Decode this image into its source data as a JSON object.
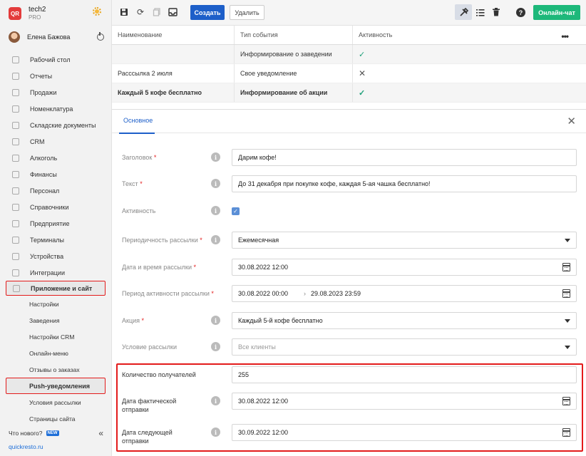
{
  "brand": {
    "logo_text": "QR",
    "name": "tech2",
    "plan": "PRO"
  },
  "user": {
    "name": "Елена Бажова"
  },
  "menu": [
    {
      "label": "Рабочий стол",
      "icon": "dashboard-icon"
    },
    {
      "label": "Отчеты",
      "icon": "chart-icon"
    },
    {
      "label": "Продажи",
      "icon": "basket-icon"
    },
    {
      "label": "Номенклатура",
      "icon": "tag-icon"
    },
    {
      "label": "Складские документы",
      "icon": "warehouse-icon"
    },
    {
      "label": "CRM",
      "icon": "crm-icon"
    },
    {
      "label": "Алкоголь",
      "icon": "glass-icon"
    },
    {
      "label": "Финансы",
      "icon": "wallet-icon"
    },
    {
      "label": "Персонал",
      "icon": "people-icon"
    },
    {
      "label": "Справочники",
      "icon": "book-icon"
    },
    {
      "label": "Предприятие",
      "icon": "building-icon"
    },
    {
      "label": "Терминалы",
      "icon": "terminal-icon"
    },
    {
      "label": "Устройства",
      "icon": "printer-icon"
    },
    {
      "label": "Интеграции",
      "icon": "link-icon"
    },
    {
      "label": "Приложение и сайт",
      "icon": "app-icon"
    }
  ],
  "submenu": [
    "Настройки",
    "Заведения",
    "Настройки CRM",
    "Онлайн-меню",
    "Отзывы о заказах",
    "Push-уведомления",
    "Условия рассылки",
    "Страницы сайта"
  ],
  "whats_new": {
    "label": "Что нового?",
    "badge": "NEW"
  },
  "site_link": "quickresto.ru",
  "toolbar": {
    "create": "Создать",
    "delete": "Удалить",
    "chat": "Онлайн-чат",
    "help": "?"
  },
  "table": {
    "headers": [
      "Наименование",
      "Тип события",
      "Активность"
    ],
    "rows": [
      {
        "name": "",
        "type": "Информирование о заведении",
        "active": "✓"
      },
      {
        "name": "Расссылка 2 июля",
        "type": "Свое уведомление",
        "active": "✕"
      },
      {
        "name": "Каждый 5 кофе бесплатно",
        "type": "Информирование об акции",
        "active": "✓"
      }
    ]
  },
  "panel": {
    "tab": "Основное",
    "fields": {
      "title": {
        "label": "Заголовок",
        "value": "Дарим кофе!"
      },
      "text": {
        "label": "Текст",
        "value": "До 31 декабря при покупке кофе, каждая 5-ая чашка бесплатно!"
      },
      "active": {
        "label": "Активность",
        "checked": true
      },
      "period": {
        "label": "Периодичность рассылки",
        "value": "Ежемесячная"
      },
      "datetime": {
        "label": "Дата и время рассылки",
        "value": "30.08.2022 12:00"
      },
      "active_period": {
        "label": "Период активности рассылки",
        "from": "30.08.2022 00:00",
        "to": "29.08.2023 23:59"
      },
      "promo": {
        "label": "Акция",
        "value": "Каждый 5-й кофе бесплатно"
      },
      "condition": {
        "label": "Условие рассылки",
        "placeholder": "Все клиенты"
      },
      "recipients": {
        "label": "Количество получателей",
        "value": "255"
      },
      "actual_send": {
        "label_1": "Дата фактической",
        "label_2": "отправки",
        "value": "30.08.2022 12:00"
      },
      "next_send": {
        "label_1": "Дата следующей",
        "label_2": "отправки",
        "value": "30.09.2022 12:00"
      }
    }
  },
  "colors": {
    "primary": "#1d5fc9",
    "chat": "#1db87a",
    "highlight": "#e31b1b",
    "check": "#1fa07a"
  }
}
